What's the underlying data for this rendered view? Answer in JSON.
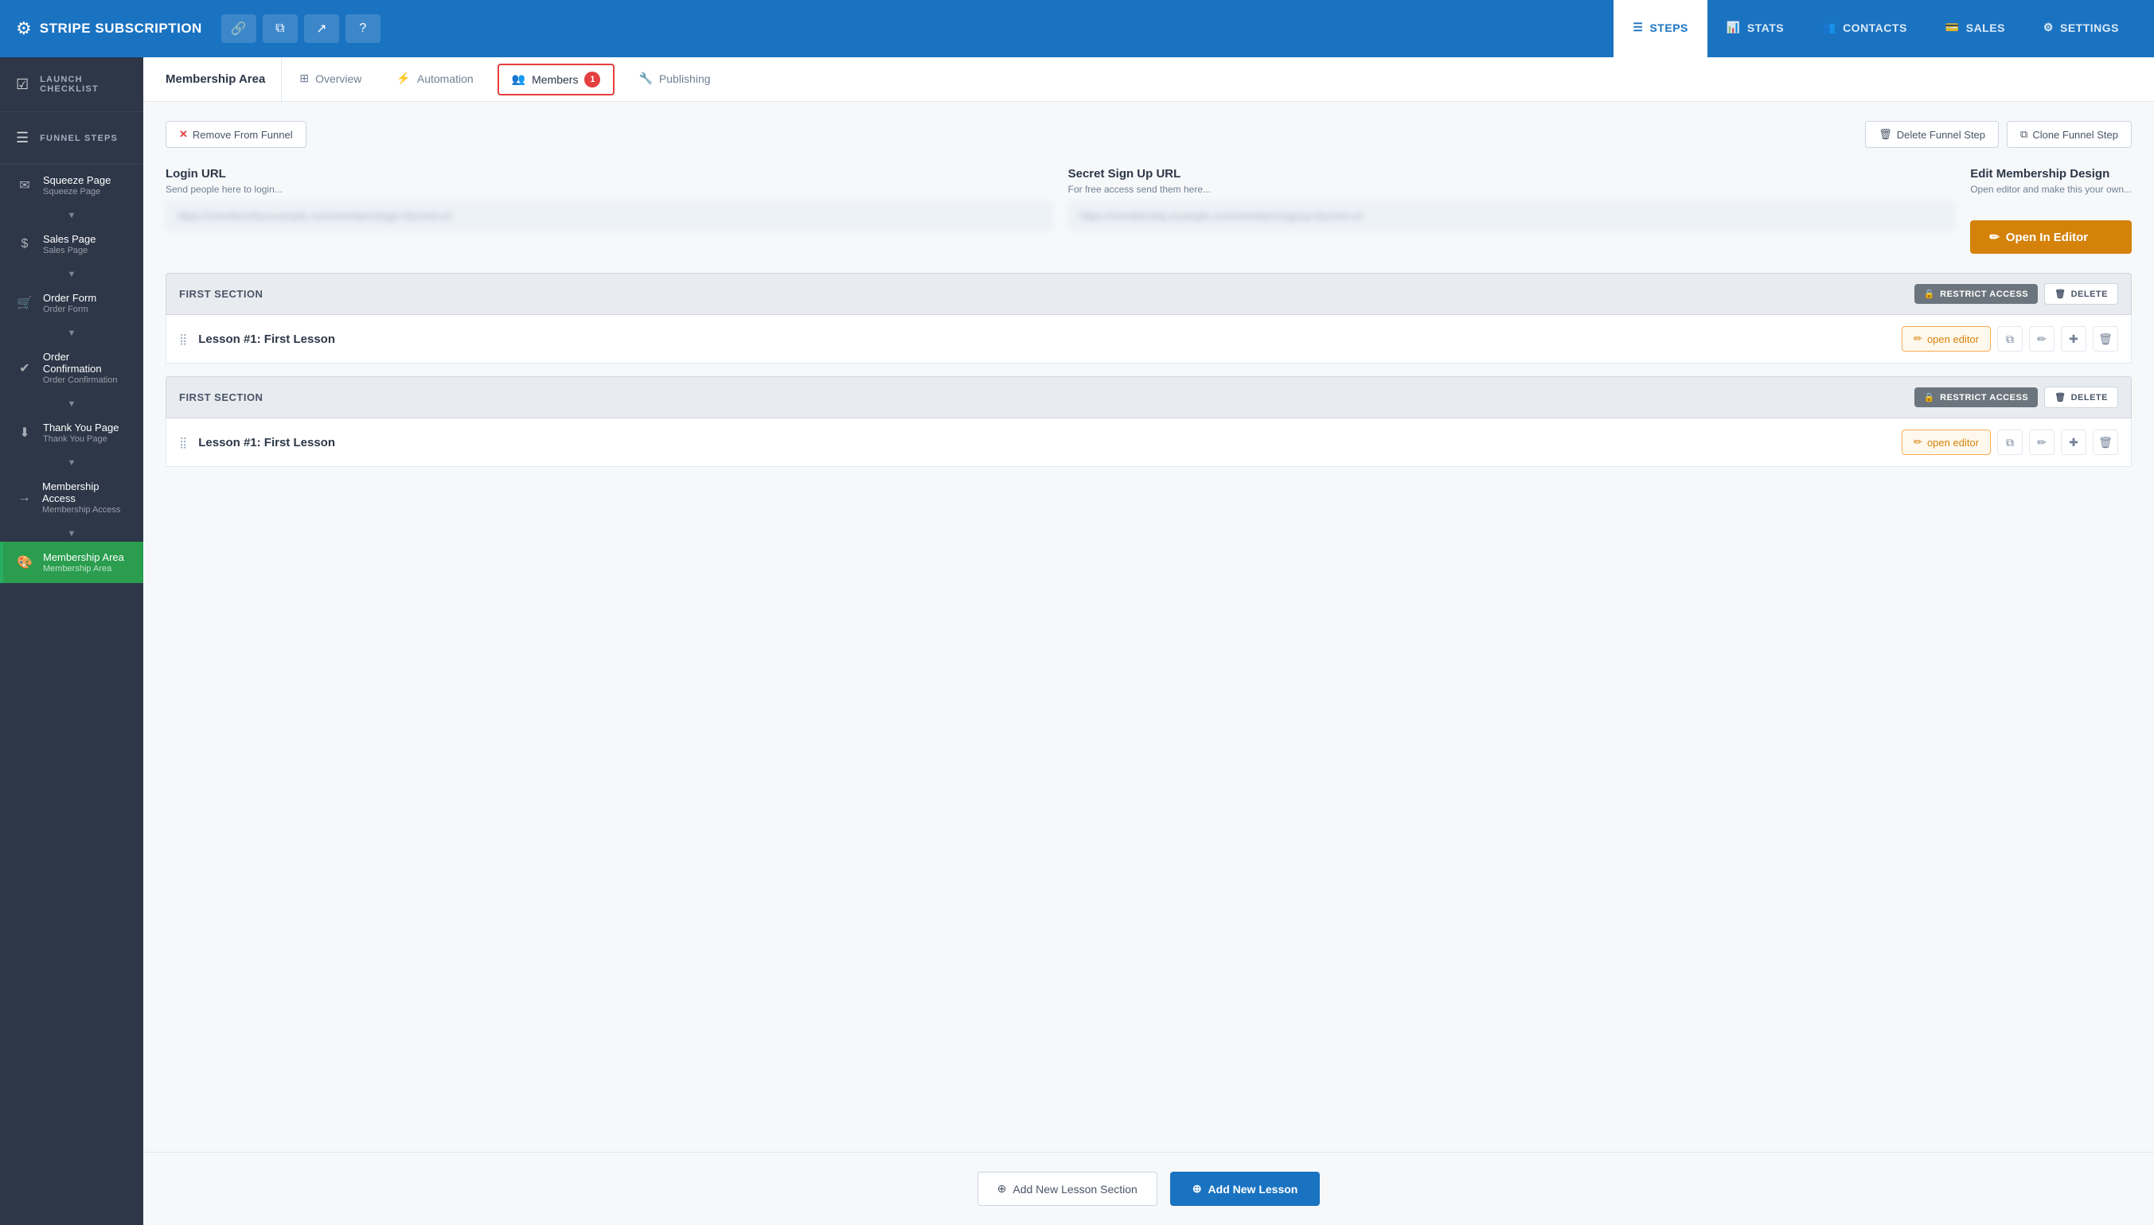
{
  "app": {
    "brand": "STRIPE SUBSCRIPTION",
    "gear_symbol": "⚙",
    "icon_link": "🔗",
    "icon_copy": "⧉",
    "icon_external": "↗",
    "icon_help": "?"
  },
  "top_nav": {
    "tabs": [
      {
        "id": "steps",
        "icon": "☰",
        "label": "STEPS",
        "active": true
      },
      {
        "id": "stats",
        "icon": "📊",
        "label": "STATS",
        "active": false
      },
      {
        "id": "contacts",
        "icon": "👥",
        "label": "CONTACTS",
        "active": false
      },
      {
        "id": "sales",
        "icon": "💳",
        "label": "SALES",
        "active": false
      },
      {
        "id": "settings",
        "icon": "⚙",
        "label": "SETTINGS",
        "active": false
      }
    ]
  },
  "sidebar": {
    "launch_checklist": "LAUNCH CHECKLIST",
    "funnel_steps": "FUNNEL STEPS",
    "items": [
      {
        "id": "squeeze",
        "icon": "✉",
        "title": "Squeeze Page",
        "subtitle": "Squeeze Page",
        "active": false
      },
      {
        "id": "sales",
        "icon": "$",
        "title": "Sales Page",
        "subtitle": "Sales Page",
        "active": false
      },
      {
        "id": "order-form",
        "icon": "🛒",
        "title": "Order Form",
        "subtitle": "Order Form",
        "active": false
      },
      {
        "id": "order-conf",
        "icon": "✔",
        "title": "Order Confirmation",
        "subtitle": "Order Confirmation",
        "active": false
      },
      {
        "id": "thank-you",
        "icon": "⬇",
        "title": "Thank You Page",
        "subtitle": "Thank You Page",
        "active": false
      },
      {
        "id": "membership-access",
        "icon": "→",
        "title": "Membership Access",
        "subtitle": "Membership Access",
        "active": false
      },
      {
        "id": "membership-area",
        "icon": "🎨",
        "title": "Membership Area",
        "subtitle": "Membership Area",
        "active": true
      }
    ]
  },
  "sub_nav": {
    "page_label": "Membership Area",
    "tabs": [
      {
        "id": "overview",
        "icon": "⊞",
        "label": "Overview",
        "active": false
      },
      {
        "id": "automation",
        "icon": "⚡",
        "label": "Automation",
        "active": false
      },
      {
        "id": "members",
        "label": "Members",
        "badge": "1",
        "highlighted": true,
        "active": false
      },
      {
        "id": "publishing",
        "icon": "🔧",
        "label": "Publishing",
        "active": false
      }
    ]
  },
  "actions": {
    "remove_from_funnel": "Remove From Funnel",
    "delete_funnel_step": "Delete Funnel Step",
    "clone_funnel_step": "Clone Funnel Step"
  },
  "url_section": {
    "login_url_label": "Login URL",
    "login_url_sublabel": "Send people here to login...",
    "login_url_placeholder": "https://membership.example.com/login",
    "secret_signup_label": "Secret Sign Up URL",
    "secret_signup_sublabel": "For free access send them here...",
    "secret_signup_placeholder": "https://membership.example.com/signup",
    "edit_design_label": "Edit Membership Design",
    "edit_design_sublabel": "Open editor and make this your own...",
    "open_editor_btn": "Open In Editor"
  },
  "sections": [
    {
      "id": "section1",
      "title": "FIRST SECTION",
      "restrict_label": "RESTRICT ACCESS",
      "delete_label": "DELETE",
      "lessons": [
        {
          "id": "lesson1",
          "title": "Lesson #1: First Lesson",
          "open_editor": "open editor"
        }
      ]
    },
    {
      "id": "section2",
      "title": "FIRST SECTION",
      "restrict_label": "RESTRICT ACCESS",
      "delete_label": "DELETE",
      "lessons": [
        {
          "id": "lesson2",
          "title": "Lesson #1: First Lesson",
          "open_editor": "open editor"
        }
      ]
    }
  ],
  "bottom": {
    "add_section_label": "Add New Lesson Section",
    "add_lesson_label": "Add New Lesson"
  }
}
